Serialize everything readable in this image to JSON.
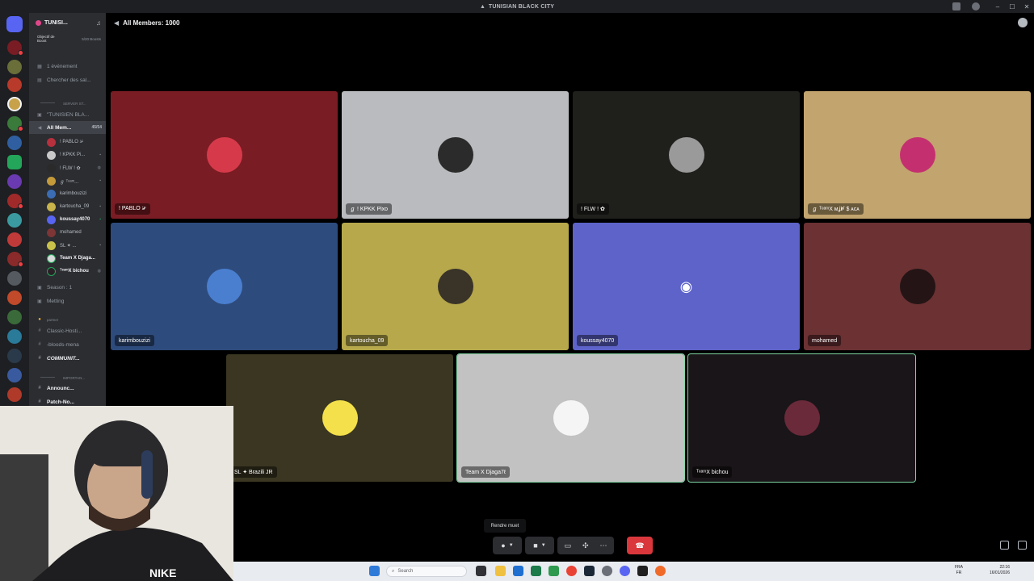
{
  "window": {
    "title": "TUNISIAN BLACK CITY"
  },
  "server": {
    "name": "TUNISI...",
    "boost_label": "Objectif de Boost",
    "boost_progress": "5/20 Boosts"
  },
  "sidebar": {
    "items": [
      {
        "label": "1 événement",
        "icon": "calendar-icon"
      },
      {
        "label": "Chercher des sal...",
        "icon": "search-icon"
      },
      {
        "label": "SERVER ST...",
        "icon": "divider-icon"
      },
      {
        "label": "\"TUNISIEN BLA...",
        "icon": "lock-icon"
      },
      {
        "label": "All Mem...",
        "count": "45/54",
        "icon": "speaker-icon"
      }
    ],
    "voice_users": [
      {
        "name": "! PABLO ቻ",
        "color": "#b7303d"
      },
      {
        "name": "! KPKK Pi...",
        "color": "#c9c9c9"
      },
      {
        "name": "! FLW ! ✿",
        "color": "#2a2a2a"
      },
      {
        "name": "ℊ ᵀᵉᵃᵐ...",
        "color": "#c49a3a"
      },
      {
        "name": "karimbouzizi",
        "color": "#3b6db5"
      },
      {
        "name": "kartoucha_09",
        "color": "#c8b44a"
      },
      {
        "name": "koussay4070",
        "color": "#5865f2"
      },
      {
        "name": "mohamed",
        "color": "#7d3535"
      },
      {
        "name": "SL ✦ ...",
        "color": "#c9c24a"
      },
      {
        "name": "Team X Djaga...",
        "color": "#d9d9d9"
      },
      {
        "name": "ᵀᵉᵃᵐX bichou",
        "color": "#2b2026"
      }
    ],
    "lower_items": [
      {
        "label": "Season : 1",
        "icon": "lock-icon"
      },
      {
        "label": "Metting",
        "icon": "lock-icon"
      },
      {
        "label": "partner",
        "icon": "hand-icon"
      },
      {
        "label": "Classic-Hosti...",
        "icon": "hash-icon"
      },
      {
        "label": "-bloods-mena",
        "icon": "hash-icon"
      },
      {
        "label": "COMMUNIT...",
        "icon": "hash-icon"
      },
      {
        "label": "IMPORTAN...",
        "icon": "divider-icon"
      },
      {
        "label": "Announc...",
        "icon": "hash-icon"
      },
      {
        "label": "Patch-No...",
        "icon": "hash-icon"
      }
    ]
  },
  "voice": {
    "header_title": "All Members: 1000",
    "tiles": [
      {
        "name": "! PABLO ቻ",
        "bg": "#7a1c24",
        "avatar": "#d63a4a"
      },
      {
        "name": "ℊ ! KPKK Pixo",
        "bg": "#b9bbbe",
        "avatar": "#2b2b2b"
      },
      {
        "name": "! FLW ! ✿",
        "bg": "#1f1f1c",
        "avatar": "#9a9a9a"
      },
      {
        "name": "ℊ ᵀᵉᵃᵐX ᴍʝ𝖉ᶠ $ ᴀᴄᴀ",
        "bg": "#c2a46e",
        "avatar": "#c4306f"
      },
      {
        "name": "karimbouzizi",
        "bg": "#2e4b7d",
        "avatar": "#4a7fd0"
      },
      {
        "name": "kartoucha_09",
        "bg": "#b6a84b",
        "avatar": "#3a3328"
      },
      {
        "name": "koussay4070",
        "bg": "#5d63c9",
        "avatar": "#5d63c9"
      },
      {
        "name": "mohamed",
        "bg": "#6b3133",
        "avatar": "#241415"
      },
      {
        "name": "SL ✦ Brazili JR",
        "bg": "#3a3621",
        "avatar": "#f4e04a"
      },
      {
        "name": "Team X Djaga7ℓ",
        "bg": "#c2c2c2",
        "avatar": "#f5f5f5"
      },
      {
        "name": "ᵀᵉᵃᵐX bichou",
        "bg": "#1a1519",
        "avatar": "#6a2a3a"
      }
    ]
  },
  "controls": {
    "tooltip": "Rendre muet",
    "mic_icon": "microphone-icon",
    "camera_icon": "video-icon",
    "share_icon": "screen-share-icon",
    "activity_icon": "activity-icon",
    "more_icon": "more-icon",
    "hangup_icon": "phone-hangup-icon"
  },
  "taskbar": {
    "search_placeholder": "Search",
    "lang": "FRA\nFR",
    "time": "22:16",
    "date": "16/01/2026"
  }
}
